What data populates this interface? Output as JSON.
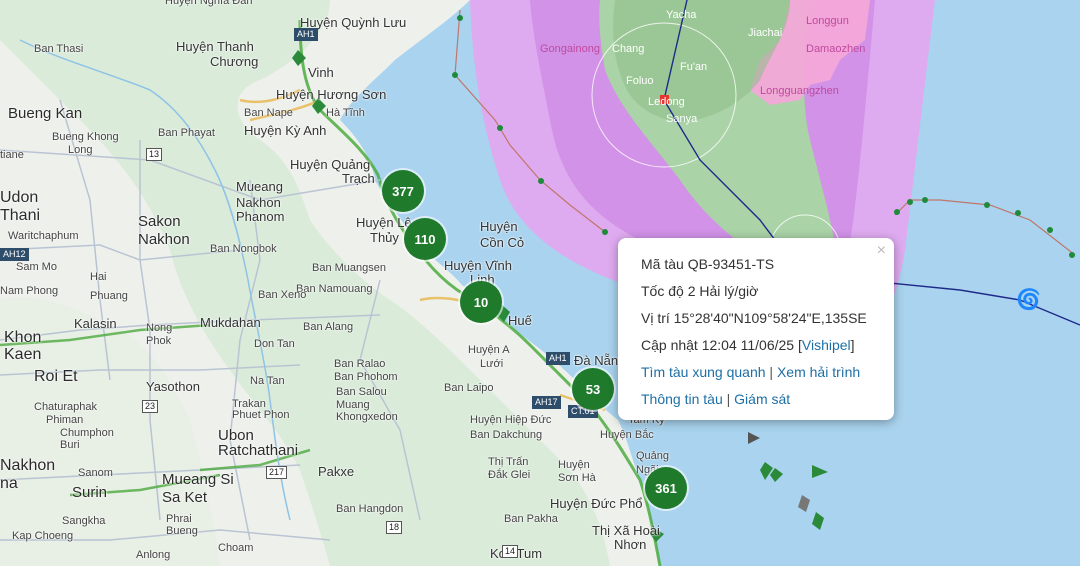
{
  "colors": {
    "sea": "#a9d3ee",
    "land": "#eef0ec",
    "forest": "#d7ead8",
    "cone_outer": "#e4a6ef",
    "cone_inner": "#cf8fe6",
    "cone_core": "#a8d7a3",
    "cn_zone": "#f3a8d8",
    "cluster": "#1f7a2c",
    "track": "#1e2a8a",
    "link": "#1d6fa5"
  },
  "place_labels": [
    {
      "text": "Huyện Nghĩa Đàn",
      "size": "small"
    },
    {
      "text": "Huyện Quỳnh Lưu",
      "size": "mid"
    },
    {
      "text": "Ban Thasi",
      "size": "small"
    },
    {
      "text": "Huyện Thanh",
      "size": "mid"
    },
    {
      "text": "Chương",
      "size": "mid"
    },
    {
      "text": "Vinh",
      "size": "mid"
    },
    {
      "text": "Huyện Hương Sơn",
      "size": "mid"
    },
    {
      "text": "Hà Tĩnh",
      "size": "small"
    },
    {
      "text": "Ban Nape",
      "size": "small"
    },
    {
      "text": "Bueng Kan",
      "size": "big2"
    },
    {
      "text": "Bueng Khong",
      "size": "small"
    },
    {
      "text": "Long",
      "size": "small"
    },
    {
      "text": "Ban Phayat",
      "size": "small"
    },
    {
      "text": "Huyện Kỳ Anh",
      "size": "mid"
    },
    {
      "text": "tiane",
      "size": "small"
    },
    {
      "text": "Huyện Quảng",
      "size": "mid"
    },
    {
      "text": "Trạch",
      "size": "mid"
    },
    {
      "text": "Mueang",
      "size": "mid"
    },
    {
      "text": "Nakhon",
      "size": "mid"
    },
    {
      "text": "Phanom",
      "size": "mid"
    },
    {
      "text": "Udon",
      "size": "big"
    },
    {
      "text": "Thani",
      "size": "big"
    },
    {
      "text": "Sakon",
      "size": "big2"
    },
    {
      "text": "Nakhon",
      "size": "big2"
    },
    {
      "text": "Waritchaphum",
      "size": "small"
    },
    {
      "text": "Huyện Lệ",
      "size": "mid"
    },
    {
      "text": "Thủy",
      "size": "mid"
    },
    {
      "text": "Huyện",
      "size": "mid"
    },
    {
      "text": "Cồn Cỏ",
      "size": "mid"
    },
    {
      "text": "Ban Nongbok",
      "size": "small"
    },
    {
      "text": "Sam Mo",
      "size": "small"
    },
    {
      "text": "Hai",
      "size": "small"
    },
    {
      "text": "Phuang",
      "size": "small"
    },
    {
      "text": "Nam Phong",
      "size": "small"
    },
    {
      "text": "Ban Muangsen",
      "size": "small"
    },
    {
      "text": "Huyện Vĩnh",
      "size": "mid"
    },
    {
      "text": "Linh",
      "size": "mid"
    },
    {
      "text": "Ban Namouang",
      "size": "small"
    },
    {
      "text": "Ban Xeno",
      "size": "small"
    },
    {
      "text": "Kalasin",
      "size": "mid"
    },
    {
      "text": "Mukdahan",
      "size": "mid"
    },
    {
      "text": "Ban Alang",
      "size": "small"
    },
    {
      "text": "Huế",
      "size": "mid"
    },
    {
      "text": "Khon",
      "size": "big"
    },
    {
      "text": "Kaen",
      "size": "big"
    },
    {
      "text": "Nong",
      "size": "small"
    },
    {
      "text": "Phok",
      "size": "small"
    },
    {
      "text": "Don Tan",
      "size": "small"
    },
    {
      "text": "Huyện A",
      "size": "small"
    },
    {
      "text": "Lưới",
      "size": "small"
    },
    {
      "text": "Roi Et",
      "size": "big"
    },
    {
      "text": "Ban Ralao",
      "size": "small"
    },
    {
      "text": "Ban Phohom",
      "size": "small"
    },
    {
      "text": "Ban Salou",
      "size": "small"
    },
    {
      "text": "Đà Nẵng",
      "size": "mid"
    },
    {
      "text": "Yasothon",
      "size": "mid"
    },
    {
      "text": "Na Tan",
      "size": "small"
    },
    {
      "text": "Ban Laipo",
      "size": "small"
    },
    {
      "text": "Chaturaphak",
      "size": "small"
    },
    {
      "text": "Phiman",
      "size": "small"
    },
    {
      "text": "Trakan",
      "size": "small"
    },
    {
      "text": "Phuet Phon",
      "size": "small"
    },
    {
      "text": "Muang",
      "size": "small"
    },
    {
      "text": "Khongxedon",
      "size": "small"
    },
    {
      "text": "Chumphon",
      "size": "small"
    },
    {
      "text": "Buri",
      "size": "small"
    },
    {
      "text": "Ubon",
      "size": "big2"
    },
    {
      "text": "Ratchathani",
      "size": "big2"
    },
    {
      "text": "Huyện Hiệp Đức",
      "size": "small"
    },
    {
      "text": "Ban Dakchung",
      "size": "small"
    },
    {
      "text": "Tam Kỳ",
      "size": "small"
    },
    {
      "text": "Huyện Bắc",
      "size": "small"
    },
    {
      "text": "Nakhon",
      "size": "big"
    },
    {
      "text": "na",
      "size": "big"
    },
    {
      "text": "Sanom",
      "size": "small"
    },
    {
      "text": "Surin",
      "size": "big2"
    },
    {
      "text": "Mueang Si",
      "size": "big2"
    },
    {
      "text": "Sa Ket",
      "size": "big2"
    },
    {
      "text": "Pakxe",
      "size": "mid"
    },
    {
      "text": "Thị Trấn",
      "size": "small"
    },
    {
      "text": "Đắk Glei",
      "size": "small"
    },
    {
      "text": "Huyện",
      "size": "small"
    },
    {
      "text": "Sơn Hà",
      "size": "small"
    },
    {
      "text": "Quảng",
      "size": "small"
    },
    {
      "text": "Ngãi",
      "size": "small"
    },
    {
      "text": "Huyện Đức Phổ",
      "size": "mid"
    },
    {
      "text": "Sangkha",
      "size": "small"
    },
    {
      "text": "Phrai",
      "size": "small"
    },
    {
      "text": "Bueng",
      "size": "small"
    },
    {
      "text": "Ban Hangdon",
      "size": "small"
    },
    {
      "text": "Ban Pakha",
      "size": "small"
    },
    {
      "text": "Thị Xã Hoài",
      "size": "mid"
    },
    {
      "text": "Nhơn",
      "size": "mid"
    },
    {
      "text": "Kap Choeng",
      "size": "small"
    },
    {
      "text": "Anlong",
      "size": "small"
    },
    {
      "text": "Choam",
      "size": "small"
    },
    {
      "text": "Kon Tum",
      "size": "mid"
    }
  ],
  "island_labels": [
    {
      "text": "Gongainong",
      "style": "zone"
    },
    {
      "text": "Chang",
      "style": "zone-white"
    },
    {
      "text": "Yacha",
      "style": "zone-white"
    },
    {
      "text": "Jiachai",
      "style": "zone-white"
    },
    {
      "text": "Fu'an",
      "style": "zone-white"
    },
    {
      "text": "Foluo",
      "style": "zone-white"
    },
    {
      "text": "Ledong",
      "style": "zone-white"
    },
    {
      "text": "Sanya",
      "style": "zone-white"
    },
    {
      "text": "Longgun",
      "style": "zone"
    },
    {
      "text": "Damaozhen",
      "style": "zone"
    },
    {
      "text": "Longguangzhen",
      "style": "zone"
    },
    {
      "text": "Huyện",
      "style": "zone"
    },
    {
      "text": "Cồn Cỏ",
      "style": "zone"
    }
  ],
  "shields": [
    {
      "text": "13"
    },
    {
      "text": "AH12"
    },
    {
      "text": "AH1"
    },
    {
      "text": "23"
    },
    {
      "text": "217"
    },
    {
      "text": "AH17"
    },
    {
      "text": "CT.01"
    },
    {
      "text": "18"
    },
    {
      "text": "14"
    },
    {
      "text": "AH1"
    }
  ],
  "clusters": [
    {
      "count": "377"
    },
    {
      "count": "110"
    },
    {
      "count": "10"
    },
    {
      "count": "53"
    },
    {
      "count": "361"
    }
  ],
  "popup": {
    "vessel_id": "Mã tàu QB-93451-TS",
    "speed": "Tốc độ 2 Hải lý/giờ",
    "position": "Vị trí 15°28'40\"N109°58'24\"E,135SE",
    "updated_prefix": "Cập nhật 12:04 11/06/25 [",
    "updated_link": "Vishipel",
    "updated_suffix": "]",
    "link_nearby": "Tìm tàu xung quanh",
    "link_track": "Xem hải trình",
    "link_info": "Thông tin tàu",
    "link_monitor": "Giám sát",
    "separator": "|",
    "close_icon": "×"
  }
}
